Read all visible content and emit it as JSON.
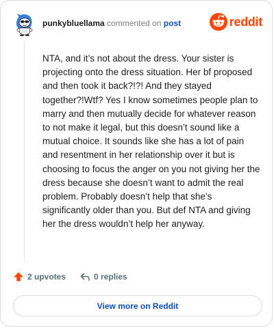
{
  "header": {
    "username": "punkybluellama",
    "action_text": "commented on",
    "target_link": "post"
  },
  "brand": {
    "logo_text": "reddit",
    "accent_color": "#ff4500",
    "link_color": "#0b4fba"
  },
  "comment": {
    "body": "NTA, and it’s not about the dress. Your sister is projecting onto the dress situation. Her bf proposed and then took it back?!?! And they stayed together?!Wtf? Yes I know sometimes people plan to marry and then mutually decide for whatever reason to not make it legal, but this doesn’t sound like a mutual choice. It sounds like she has a lot of pain and resentment in her relationship over it but is choosing to focus the anger on you not giving her the dress because she doesn’t want to admit the real problem. Probably doesn’t help that she’s significantly older than you. But def NTA and giving her the dress wouldn’t help her anyway."
  },
  "actions": {
    "upvotes_label": "2 upvotes",
    "replies_label": "0 replies",
    "upvote_icon": "upvote-arrow-icon",
    "reply_icon": "reply-arrow-icon"
  },
  "footer": {
    "view_more_label": "View more on Reddit"
  }
}
